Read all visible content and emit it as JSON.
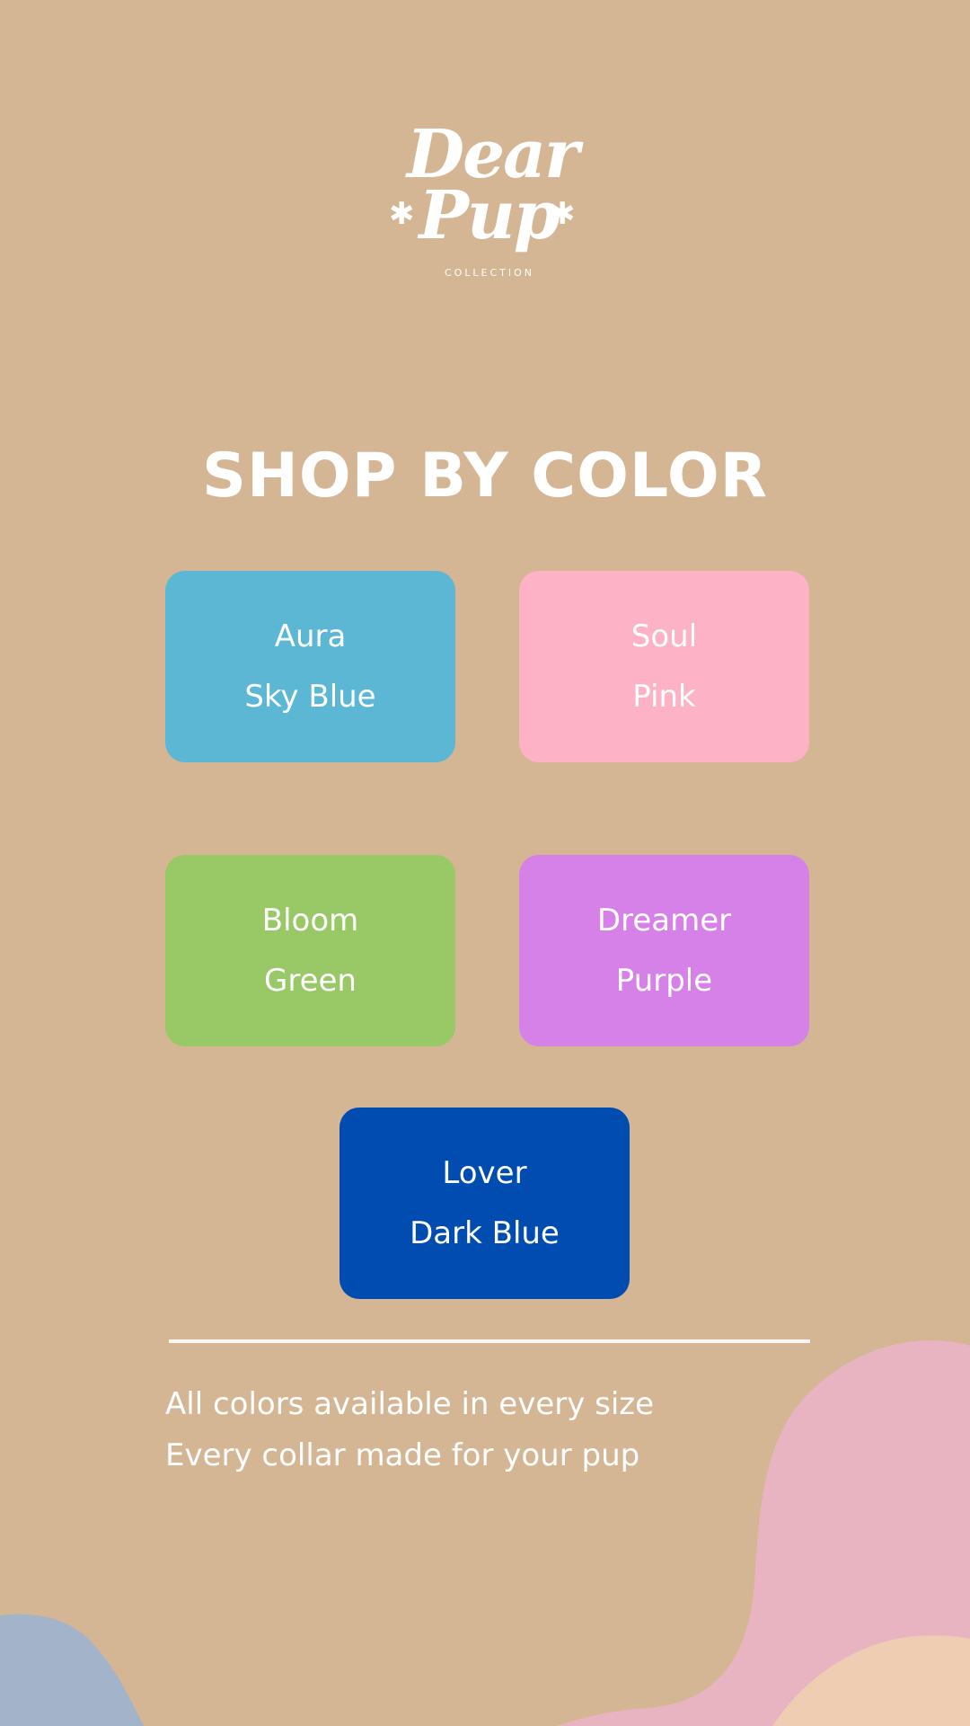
{
  "brand": {
    "logo_line1": "Dear",
    "logo_line2": "Pup",
    "logo_sub": "COLLECTION",
    "star_glyph": "✱"
  },
  "heading": "SHOP BY COLOR",
  "colors": [
    {
      "name": "Aura",
      "shade": "Sky Blue",
      "hex": "#5bb7d3"
    },
    {
      "name": "Soul",
      "shade": "Pink",
      "hex": "#feb2c6"
    },
    {
      "name": "Bloom",
      "shade": "Green",
      "hex": "#99c866"
    },
    {
      "name": "Dreamer",
      "shade": "Purple",
      "hex": "#d581e8"
    },
    {
      "name": "Lover",
      "shade": "Dark Blue",
      "hex": "#004cb1"
    }
  ],
  "footer_notes": [
    "All colors available in every size",
    "Every collar made for your pup"
  ],
  "theme": {
    "background": "#d4b695",
    "blob_pink": "#e9b4c2",
    "blob_peach": "#eecdb2",
    "blob_blue": "#a3b4ca"
  }
}
